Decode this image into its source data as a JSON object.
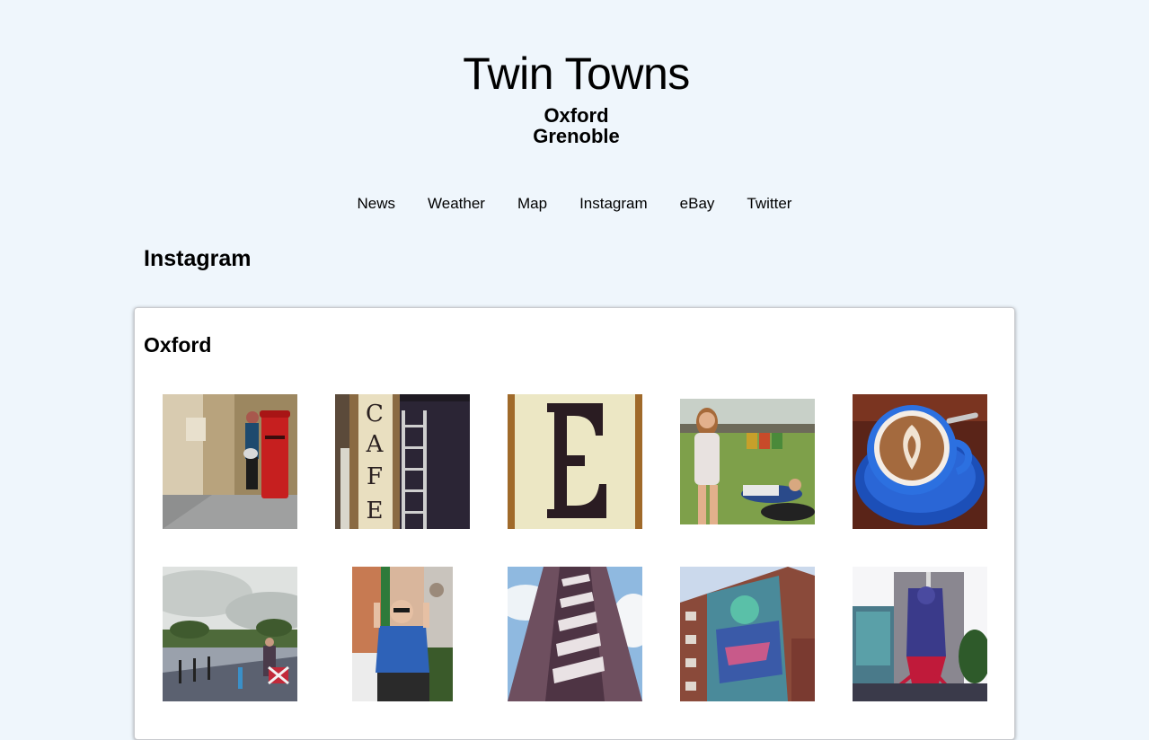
{
  "header": {
    "title": "Twin Towns",
    "towns": [
      "Oxford",
      "Grenoble"
    ]
  },
  "nav": {
    "items": [
      {
        "label": "News"
      },
      {
        "label": "Weather"
      },
      {
        "label": "Map"
      },
      {
        "label": "Instagram"
      },
      {
        "label": "eBay"
      },
      {
        "label": "Twitter"
      }
    ]
  },
  "main": {
    "section_title": "Instagram",
    "panel": {
      "title": "Oxford",
      "photos": [
        {
          "subject": "woman beside red post box"
        },
        {
          "subject": "cafe sign and ladder"
        },
        {
          "subject": "letter E sign"
        },
        {
          "subject": "festival crowd on grass"
        },
        {
          "subject": "latte art in blue cup"
        },
        {
          "subject": "street under cloudy sky"
        },
        {
          "subject": "man making peace signs"
        },
        {
          "subject": "striped tower block"
        },
        {
          "subject": "mural on brick building"
        },
        {
          "subject": "mural on tower block"
        }
      ]
    }
  },
  "colors": {
    "page_background": "#eff6fc",
    "panel_background": "#ffffff",
    "text": "#000000"
  }
}
